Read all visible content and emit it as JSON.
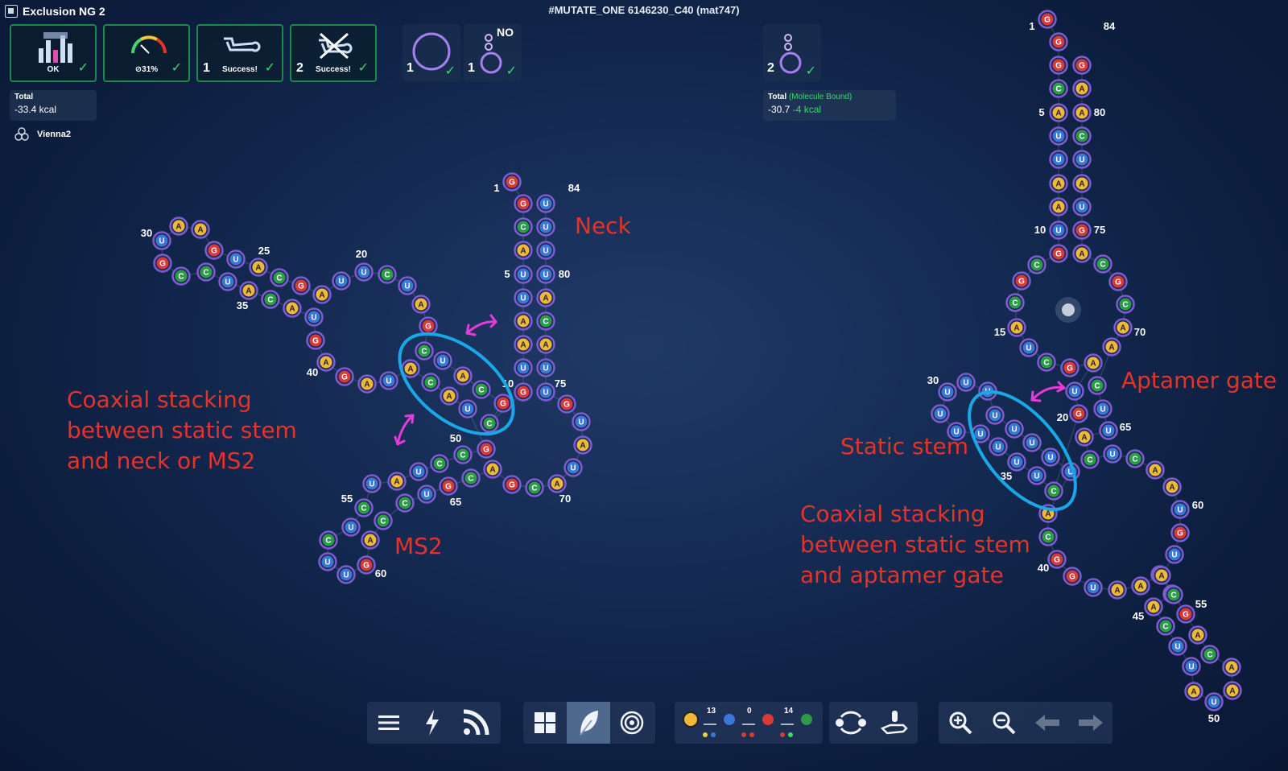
{
  "header": {
    "app_title": "Exclusion NG 2",
    "puzzle_title": "#MUTATE_ONE 6146230_C40 (mat747)"
  },
  "constraints": [
    {
      "icon": "bars-icon",
      "label": "OK",
      "num": ""
    },
    {
      "icon": "gauge-icon",
      "label": "⊘31%",
      "num": ""
    },
    {
      "icon": "strand-icon",
      "label": "Success!",
      "num": "1"
    },
    {
      "icon": "crossed-strand-icon",
      "label": "Success!",
      "num": "2"
    }
  ],
  "states": {
    "state1_num": "1",
    "state2_num": "1",
    "state2_no": "NO",
    "right_num": "2"
  },
  "energy_left": {
    "label": "Total",
    "value": "-33.4 kcal"
  },
  "energy_right": {
    "label": "Total",
    "label_extra": "(Molecule Bound)",
    "value": "-30.7",
    "value_extra": "-4 kcal"
  },
  "engine": "Vienna2",
  "annotations": {
    "left_coaxial": "Coaxial stacking between static stem and neck or MS2",
    "neck": "Neck",
    "ms2": "MS2",
    "aptamer_gate": "Aptamer gate",
    "static_stem": "Static stem",
    "right_coaxial": "Coaxial stacking between static stem and aptamer gate"
  },
  "palette": {
    "a_count": "13",
    "u_count": "0",
    "g_count": "14"
  },
  "colors": {
    "A": "#f0b83a",
    "U": "#3a78d8",
    "G": "#d83a3a",
    "C": "#2e9b4a",
    "ring": "#7d5bd0",
    "annotation": "#e5332a",
    "circle": "#1aa7e6",
    "arrow": "#e83ad8",
    "success": "#3ed66e"
  },
  "left_structure": {
    "labels": [
      "1",
      "84",
      "5",
      "80",
      "10",
      "75",
      "20",
      "25",
      "30",
      "35",
      "40",
      "50",
      "55",
      "60",
      "65",
      "70"
    ],
    "nucleotides": [
      {
        "b": "G"
      },
      {
        "b": "G"
      },
      {
        "b": "C"
      },
      {
        "b": "A"
      },
      {
        "b": "U"
      },
      {
        "b": "U"
      },
      {
        "b": "A"
      },
      {
        "b": "A"
      },
      {
        "b": "U"
      },
      {
        "b": "G"
      },
      {
        "b": "C"
      },
      {
        "b": "G"
      },
      {
        "b": "C"
      },
      {
        "b": "A"
      },
      {
        "b": "U"
      },
      {
        "b": "C"
      },
      {
        "b": "G"
      },
      {
        "b": "A"
      },
      {
        "b": "U"
      },
      {
        "b": "C"
      },
      {
        "b": "U"
      },
      {
        "b": "U"
      },
      {
        "b": "A"
      },
      {
        "b": "G"
      },
      {
        "b": "C"
      },
      {
        "b": "A"
      },
      {
        "b": "U"
      },
      {
        "b": "G"
      },
      {
        "b": "A"
      },
      {
        "b": "A"
      },
      {
        "b": "U"
      },
      {
        "b": "G"
      },
      {
        "b": "C"
      },
      {
        "b": "C"
      },
      {
        "b": "U"
      },
      {
        "b": "A"
      },
      {
        "b": "C"
      },
      {
        "b": "A"
      },
      {
        "b": "U"
      },
      {
        "b": "G"
      },
      {
        "b": "A"
      },
      {
        "b": "G"
      },
      {
        "b": "A"
      },
      {
        "b": "U"
      },
      {
        "b": "A"
      },
      {
        "b": "C"
      },
      {
        "b": "A"
      },
      {
        "b": "U"
      },
      {
        "b": "G"
      },
      {
        "b": "C"
      },
      {
        "b": "C"
      },
      {
        "b": "U"
      },
      {
        "b": "A"
      },
      {
        "b": "U"
      },
      {
        "b": "C"
      },
      {
        "b": "U"
      },
      {
        "b": "C"
      },
      {
        "b": "U"
      },
      {
        "b": "U"
      },
      {
        "b": "G"
      },
      {
        "b": "A"
      },
      {
        "b": "C"
      },
      {
        "b": "C"
      },
      {
        "b": "U"
      },
      {
        "b": "G"
      },
      {
        "b": "C"
      },
      {
        "b": "A"
      },
      {
        "b": "G"
      },
      {
        "b": "C"
      },
      {
        "b": "A"
      },
      {
        "b": "U"
      },
      {
        "b": "A"
      },
      {
        "b": "U"
      },
      {
        "b": "G"
      },
      {
        "b": "U"
      },
      {
        "b": "U"
      },
      {
        "b": "A"
      },
      {
        "b": "C"
      },
      {
        "b": "A"
      },
      {
        "b": "U"
      },
      {
        "b": "U"
      },
      {
        "b": "U"
      },
      {
        "b": "U"
      }
    ]
  },
  "right_structure": {
    "labels": [
      "1",
      "84",
      "5",
      "80",
      "10",
      "75",
      "15",
      "70",
      "20",
      "65",
      "30",
      "35",
      "40",
      "45",
      "50",
      "55",
      "60"
    ],
    "nucleotides": [
      {
        "b": "G"
      },
      {
        "b": "G"
      },
      {
        "b": "G"
      },
      {
        "b": "C"
      },
      {
        "b": "A"
      },
      {
        "b": "U"
      },
      {
        "b": "U"
      },
      {
        "b": "A"
      },
      {
        "b": "A"
      },
      {
        "b": "U"
      },
      {
        "b": "G"
      },
      {
        "b": "C"
      },
      {
        "b": "G"
      },
      {
        "b": "C"
      },
      {
        "b": "A"
      },
      {
        "b": "U"
      },
      {
        "b": "C"
      },
      {
        "b": "G"
      },
      {
        "b": "A"
      },
      {
        "b": "U"
      },
      {
        "b": "G"
      },
      {
        "b": "C"
      },
      {
        "b": "U"
      },
      {
        "b": "U"
      },
      {
        "b": "U"
      },
      {
        "b": "U"
      },
      {
        "b": "U"
      },
      {
        "b": "U"
      },
      {
        "b": "U"
      },
      {
        "b": "U"
      },
      {
        "b": "U"
      },
      {
        "b": "U"
      },
      {
        "b": "U"
      },
      {
        "b": "U"
      },
      {
        "b": "U"
      },
      {
        "b": "U"
      },
      {
        "b": "A"
      },
      {
        "b": "C"
      },
      {
        "b": "G"
      },
      {
        "b": "G"
      },
      {
        "b": "U"
      },
      {
        "b": "A"
      },
      {
        "b": "A"
      },
      {
        "b": "U"
      },
      {
        "b": "G"
      },
      {
        "b": "A"
      },
      {
        "b": "C"
      },
      {
        "b": "U"
      },
      {
        "b": "U"
      },
      {
        "b": "A"
      },
      {
        "b": "U"
      },
      {
        "b": "A"
      },
      {
        "b": "A"
      },
      {
        "b": "C"
      },
      {
        "b": "A"
      },
      {
        "b": "G"
      },
      {
        "b": "C"
      },
      {
        "b": "A"
      },
      {
        "b": "U"
      },
      {
        "b": "G"
      },
      {
        "b": "U"
      },
      {
        "b": "A"
      },
      {
        "b": "A"
      },
      {
        "b": "C"
      },
      {
        "b": "U"
      },
      {
        "b": "C"
      },
      {
        "b": "A"
      },
      {
        "b": "U"
      },
      {
        "b": "U"
      },
      {
        "b": "C"
      },
      {
        "b": "A"
      },
      {
        "b": "A"
      },
      {
        "b": "C"
      },
      {
        "b": "G"
      },
      {
        "b": "C"
      },
      {
        "b": "A"
      },
      {
        "b": "G"
      },
      {
        "b": "U"
      },
      {
        "b": "A"
      },
      {
        "b": "U"
      },
      {
        "b": "C"
      },
      {
        "b": "A"
      },
      {
        "b": "A"
      },
      {
        "b": "G"
      }
    ]
  }
}
